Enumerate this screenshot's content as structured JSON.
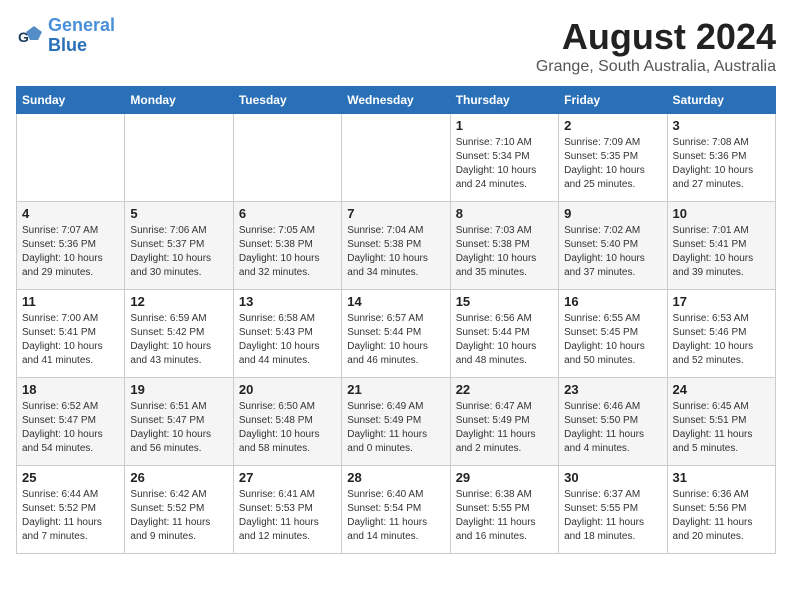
{
  "header": {
    "logo_line1": "General",
    "logo_line2": "Blue",
    "main_title": "August 2024",
    "subtitle": "Grange, South Australia, Australia"
  },
  "columns": [
    "Sunday",
    "Monday",
    "Tuesday",
    "Wednesday",
    "Thursday",
    "Friday",
    "Saturday"
  ],
  "weeks": [
    [
      {
        "day": "",
        "info": ""
      },
      {
        "day": "",
        "info": ""
      },
      {
        "day": "",
        "info": ""
      },
      {
        "day": "",
        "info": ""
      },
      {
        "day": "1",
        "info": "Sunrise: 7:10 AM\nSunset: 5:34 PM\nDaylight: 10 hours\nand 24 minutes."
      },
      {
        "day": "2",
        "info": "Sunrise: 7:09 AM\nSunset: 5:35 PM\nDaylight: 10 hours\nand 25 minutes."
      },
      {
        "day": "3",
        "info": "Sunrise: 7:08 AM\nSunset: 5:36 PM\nDaylight: 10 hours\nand 27 minutes."
      }
    ],
    [
      {
        "day": "4",
        "info": "Sunrise: 7:07 AM\nSunset: 5:36 PM\nDaylight: 10 hours\nand 29 minutes."
      },
      {
        "day": "5",
        "info": "Sunrise: 7:06 AM\nSunset: 5:37 PM\nDaylight: 10 hours\nand 30 minutes."
      },
      {
        "day": "6",
        "info": "Sunrise: 7:05 AM\nSunset: 5:38 PM\nDaylight: 10 hours\nand 32 minutes."
      },
      {
        "day": "7",
        "info": "Sunrise: 7:04 AM\nSunset: 5:38 PM\nDaylight: 10 hours\nand 34 minutes."
      },
      {
        "day": "8",
        "info": "Sunrise: 7:03 AM\nSunset: 5:38 PM\nDaylight: 10 hours\nand 35 minutes."
      },
      {
        "day": "9",
        "info": "Sunrise: 7:02 AM\nSunset: 5:40 PM\nDaylight: 10 hours\nand 37 minutes."
      },
      {
        "day": "10",
        "info": "Sunrise: 7:01 AM\nSunset: 5:41 PM\nDaylight: 10 hours\nand 39 minutes."
      }
    ],
    [
      {
        "day": "11",
        "info": "Sunrise: 7:00 AM\nSunset: 5:41 PM\nDaylight: 10 hours\nand 41 minutes."
      },
      {
        "day": "12",
        "info": "Sunrise: 6:59 AM\nSunset: 5:42 PM\nDaylight: 10 hours\nand 43 minutes."
      },
      {
        "day": "13",
        "info": "Sunrise: 6:58 AM\nSunset: 5:43 PM\nDaylight: 10 hours\nand 44 minutes."
      },
      {
        "day": "14",
        "info": "Sunrise: 6:57 AM\nSunset: 5:44 PM\nDaylight: 10 hours\nand 46 minutes."
      },
      {
        "day": "15",
        "info": "Sunrise: 6:56 AM\nSunset: 5:44 PM\nDaylight: 10 hours\nand 48 minutes."
      },
      {
        "day": "16",
        "info": "Sunrise: 6:55 AM\nSunset: 5:45 PM\nDaylight: 10 hours\nand 50 minutes."
      },
      {
        "day": "17",
        "info": "Sunrise: 6:53 AM\nSunset: 5:46 PM\nDaylight: 10 hours\nand 52 minutes."
      }
    ],
    [
      {
        "day": "18",
        "info": "Sunrise: 6:52 AM\nSunset: 5:47 PM\nDaylight: 10 hours\nand 54 minutes."
      },
      {
        "day": "19",
        "info": "Sunrise: 6:51 AM\nSunset: 5:47 PM\nDaylight: 10 hours\nand 56 minutes."
      },
      {
        "day": "20",
        "info": "Sunrise: 6:50 AM\nSunset: 5:48 PM\nDaylight: 10 hours\nand 58 minutes."
      },
      {
        "day": "21",
        "info": "Sunrise: 6:49 AM\nSunset: 5:49 PM\nDaylight: 11 hours\nand 0 minutes."
      },
      {
        "day": "22",
        "info": "Sunrise: 6:47 AM\nSunset: 5:49 PM\nDaylight: 11 hours\nand 2 minutes."
      },
      {
        "day": "23",
        "info": "Sunrise: 6:46 AM\nSunset: 5:50 PM\nDaylight: 11 hours\nand 4 minutes."
      },
      {
        "day": "24",
        "info": "Sunrise: 6:45 AM\nSunset: 5:51 PM\nDaylight: 11 hours\nand 5 minutes."
      }
    ],
    [
      {
        "day": "25",
        "info": "Sunrise: 6:44 AM\nSunset: 5:52 PM\nDaylight: 11 hours\nand 7 minutes."
      },
      {
        "day": "26",
        "info": "Sunrise: 6:42 AM\nSunset: 5:52 PM\nDaylight: 11 hours\nand 9 minutes."
      },
      {
        "day": "27",
        "info": "Sunrise: 6:41 AM\nSunset: 5:53 PM\nDaylight: 11 hours\nand 12 minutes."
      },
      {
        "day": "28",
        "info": "Sunrise: 6:40 AM\nSunset: 5:54 PM\nDaylight: 11 hours\nand 14 minutes."
      },
      {
        "day": "29",
        "info": "Sunrise: 6:38 AM\nSunset: 5:55 PM\nDaylight: 11 hours\nand 16 minutes."
      },
      {
        "day": "30",
        "info": "Sunrise: 6:37 AM\nSunset: 5:55 PM\nDaylight: 11 hours\nand 18 minutes."
      },
      {
        "day": "31",
        "info": "Sunrise: 6:36 AM\nSunset: 5:56 PM\nDaylight: 11 hours\nand 20 minutes."
      }
    ]
  ]
}
